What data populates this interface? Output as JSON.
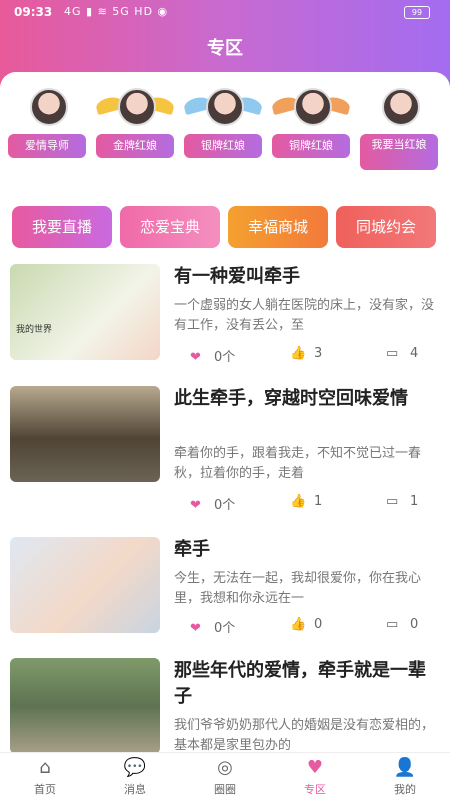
{
  "status": {
    "time": "09:33",
    "icons": "4G ▮ ≋ 5G HD ◉",
    "battery": "99"
  },
  "header": {
    "title": "专区"
  },
  "badges": [
    {
      "label": "爱情导师"
    },
    {
      "label": "金牌红娘"
    },
    {
      "label": "银牌红娘"
    },
    {
      "label": "铜牌红娘"
    },
    {
      "label": "我要当红娘"
    }
  ],
  "pills": [
    {
      "label": "我要直播"
    },
    {
      "label": "恋爱宝典"
    },
    {
      "label": "幸福商城"
    },
    {
      "label": "同城约会"
    }
  ],
  "articles": [
    {
      "title": "有一种爱叫牵手",
      "desc": "一个虚弱的女人躺在医院的床上，没有家，没有工作，没有丢公，至",
      "thumb_caption": "我的世界",
      "favorites": "0个",
      "likes": "3",
      "comments": "4"
    },
    {
      "title": "此生牵手，穿越时空回味爱情",
      "desc": "牵着你的手，跟着我走，不知不觉已过一春秋，拉着你的手，走着",
      "thumb_caption": "",
      "favorites": "0个",
      "likes": "1",
      "comments": "1"
    },
    {
      "title": "牵手",
      "desc": "今生，无法在一起，我却很爱你，你在我心里，我想和你永远在一",
      "thumb_caption": "",
      "favorites": "0个",
      "likes": "0",
      "comments": "0"
    },
    {
      "title": "那些年代的爱情，牵手就是一辈子",
      "desc": "我们爷爷奶奶那代人的婚姻是没有恋爱相的，基本都是家里包办的",
      "thumb_caption": "",
      "favorites": "",
      "likes": "",
      "comments": ""
    }
  ],
  "tabs": [
    {
      "label": "首页",
      "icon": "home-icon"
    },
    {
      "label": "消息",
      "icon": "chat-icon"
    },
    {
      "label": "圈圈",
      "icon": "circle-icon"
    },
    {
      "label": "专区",
      "icon": "heart-icon"
    },
    {
      "label": "我的",
      "icon": "user-icon"
    }
  ],
  "colors": {
    "accent": "#e85aa0",
    "header_from": "#e85a9a",
    "header_to": "#a36cf0"
  }
}
